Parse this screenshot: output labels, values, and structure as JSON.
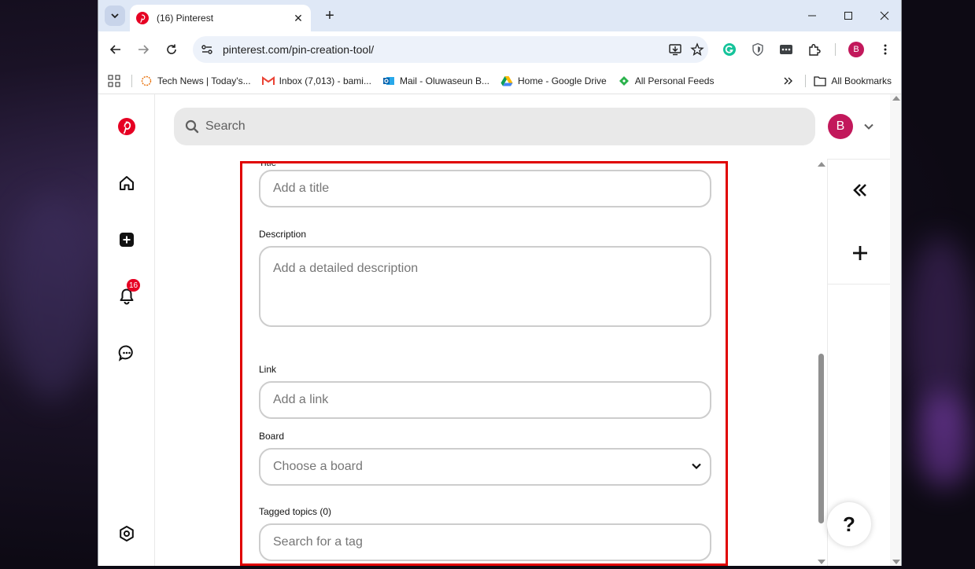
{
  "browser": {
    "tab": {
      "title": "(16) Pinterest"
    },
    "url": "pinterest.com/pin-creation-tool/",
    "profile_initial": "B",
    "bookmarks": [
      {
        "label": "Tech News | Today's..."
      },
      {
        "label": "Inbox (7,013) - bami..."
      },
      {
        "label": "Mail - Oluwaseun B..."
      },
      {
        "label": "Home - Google Drive"
      },
      {
        "label": "All Personal Feeds"
      }
    ],
    "all_bookmarks": "All Bookmarks"
  },
  "pinterest": {
    "notifications_count": "16",
    "search": {
      "placeholder": "Search"
    },
    "avatar_initial": "B",
    "form": {
      "title_label_cut": "Title",
      "title_placeholder": "Add a title",
      "description_label": "Description",
      "description_placeholder": "Add a detailed description",
      "link_label": "Link",
      "link_placeholder": "Add a link",
      "board_label": "Board",
      "board_placeholder": "Choose a board",
      "tags_label": "Tagged topics (0)",
      "tags_placeholder": "Search for a tag"
    },
    "help_label": "?"
  },
  "colors": {
    "pinterest_red": "#e60023",
    "avatar": "#c2185b",
    "highlight": "#e00000"
  }
}
